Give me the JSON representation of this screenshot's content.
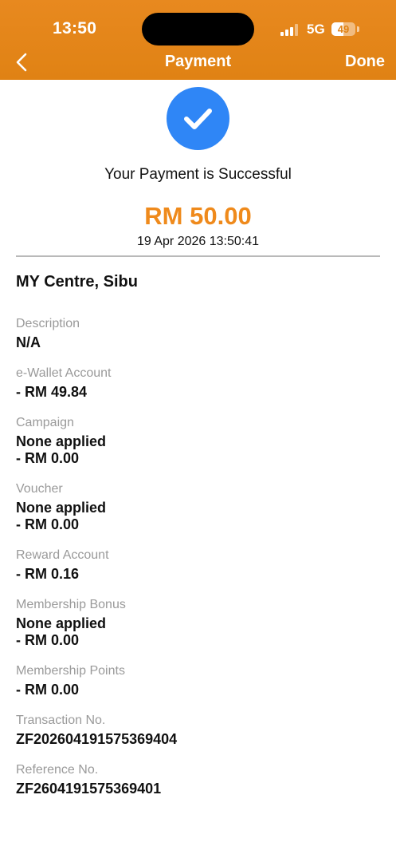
{
  "status_bar": {
    "time": "13:50",
    "network": "5G",
    "battery": "49",
    "battery_level": 0.49
  },
  "nav": {
    "title": "Payment",
    "done_label": "Done"
  },
  "summary": {
    "message": "Your Payment is Successful",
    "amount": "RM 50.00",
    "datetime": "19 Apr 2026 13:50:41",
    "merchant": "MY Centre, Sibu"
  },
  "details": {
    "description": {
      "label": "Description",
      "value": "N/A"
    },
    "ewallet": {
      "label": "e-Wallet Account",
      "value": "- RM 49.84"
    },
    "campaign": {
      "label": "Campaign",
      "value": "None applied",
      "value2": "- RM 0.00"
    },
    "voucher": {
      "label": "Voucher",
      "value": "None applied",
      "value2": "- RM 0.00"
    },
    "reward": {
      "label": "Reward Account",
      "value": "- RM 0.16"
    },
    "membership_bonus": {
      "label": "Membership Bonus",
      "value": "None applied",
      "value2": "- RM 0.00"
    },
    "membership_points": {
      "label": "Membership Points",
      "value": "- RM 0.00"
    },
    "transaction_no": {
      "label": "Transaction No.",
      "value": "ZF202604191575369404"
    },
    "reference_no": {
      "label": "Reference No.",
      "value": "ZF2604191575369401"
    }
  },
  "colors": {
    "header": "#e08214",
    "accent_amount": "#ef8a1c",
    "success_circle": "#2f86f6"
  },
  "icons": {
    "back": "chevron-left-icon",
    "success": "check-icon"
  }
}
